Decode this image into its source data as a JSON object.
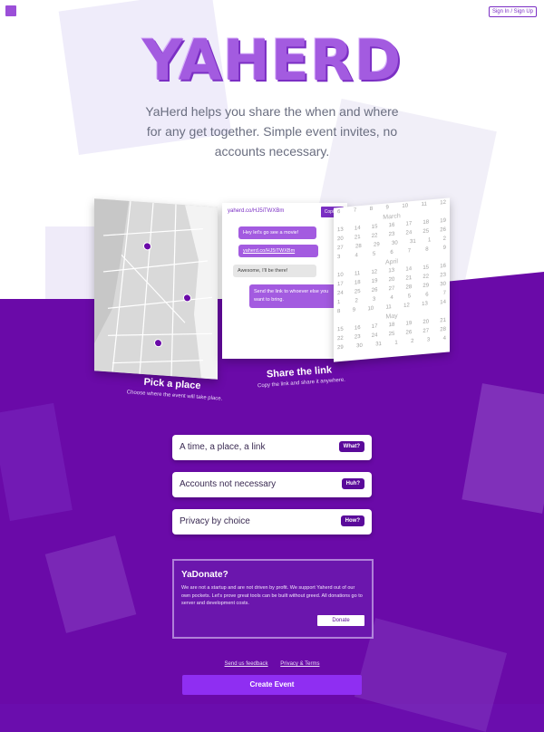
{
  "header": {
    "signin_label": "Sign In / Sign Up"
  },
  "hero": {
    "title": "YAHERD",
    "tagline": "YaHerd helps you share the when and where for any get together. Simple event invites, no accounts necessary."
  },
  "panels": [
    {
      "title": "Pick a place",
      "subtitle": "Choose where the event will take place."
    },
    {
      "title": "Share the link",
      "subtitle": "Copy the link and share it anywhere."
    }
  ],
  "chat": {
    "url": "yaherd.co/HJ5iTWXBm",
    "copied_label": "Copied!",
    "messages": [
      "Hey let's go see a movie!",
      "yaherd.co/HJ5iTWXBm",
      "Awesome, I'll be there!",
      "Send the link to whoever else you want to bring."
    ]
  },
  "calendar": {
    "months": [
      "March",
      "April",
      "May"
    ],
    "rows": [
      [
        "6",
        "7",
        "8",
        "9",
        "10",
        "11",
        "12"
      ],
      [
        "13",
        "14",
        "15",
        "16",
        "17",
        "18",
        "19"
      ],
      [
        "20",
        "21",
        "22",
        "23",
        "24",
        "25",
        "26"
      ],
      [
        "27",
        "28",
        "29",
        "30",
        "31",
        "1",
        "2"
      ],
      [
        "3",
        "4",
        "5",
        "6",
        "7",
        "8",
        "9"
      ],
      [
        "10",
        "11",
        "12",
        "13",
        "14",
        "15",
        "16"
      ],
      [
        "17",
        "18",
        "19",
        "20",
        "21",
        "22",
        "23"
      ],
      [
        "24",
        "25",
        "26",
        "27",
        "28",
        "29",
        "30"
      ],
      [
        "1",
        "2",
        "3",
        "4",
        "5",
        "6",
        "7"
      ],
      [
        "8",
        "9",
        "10",
        "11",
        "12",
        "13",
        "14"
      ],
      [
        "15",
        "16",
        "17",
        "18",
        "19",
        "20",
        "21"
      ],
      [
        "22",
        "23",
        "24",
        "25",
        "26",
        "27",
        "28"
      ],
      [
        "29",
        "30",
        "31",
        "1",
        "2",
        "3",
        "4"
      ]
    ]
  },
  "features": [
    {
      "label": "A time, a place, a link",
      "button": "What?"
    },
    {
      "label": "Accounts not necessary",
      "button": "Huh?"
    },
    {
      "label": "Privacy by choice",
      "button": "How?"
    }
  ],
  "donate": {
    "title": "YaDonate?",
    "text": "We are not a startup and are not driven by profit. We support Yaherd out of our own pockets. Let's prove great tools can be built without greed. All donations go to server and development costs.",
    "button": "Donate"
  },
  "footer": {
    "feedback": "Send us feedback",
    "privacy": "Privacy & Terms",
    "create_button": "Create Event"
  },
  "colors": {
    "brand": "#6a0aa8",
    "accent": "#a35be0"
  }
}
